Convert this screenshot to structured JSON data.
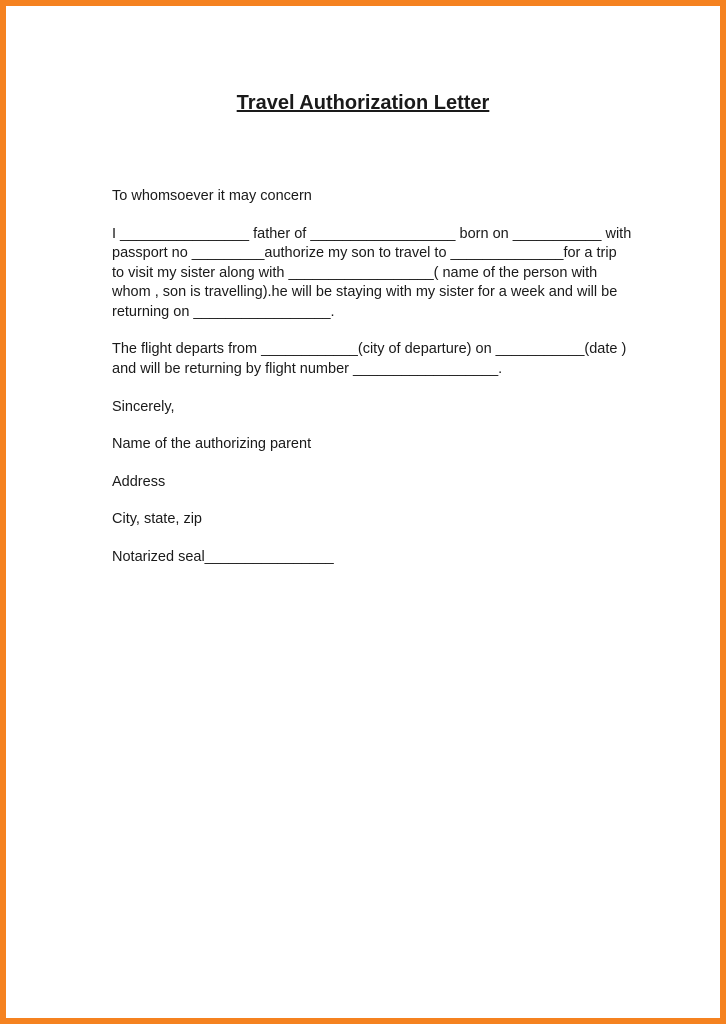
{
  "title": "Travel Authorization Letter",
  "salutation": "To whomsoever it may concern",
  "body_para1": "I ________________ father of __________________ born on ___________ with passport no _________authorize my son to travel to ______________for a trip to visit my sister along with __________________( name of the person with whom , son is travelling).he will be staying with my sister for a week and will be returning on _________________.",
  "body_para2": "The flight departs from ____________(city of departure) on ___________(date ) and will be returning by flight number __________________.",
  "closing": "Sincerely,",
  "sig_name": "Name of the authorizing parent",
  "sig_address": "Address",
  "sig_csz": "City, state, zip",
  "notary": "Notarized seal________________"
}
